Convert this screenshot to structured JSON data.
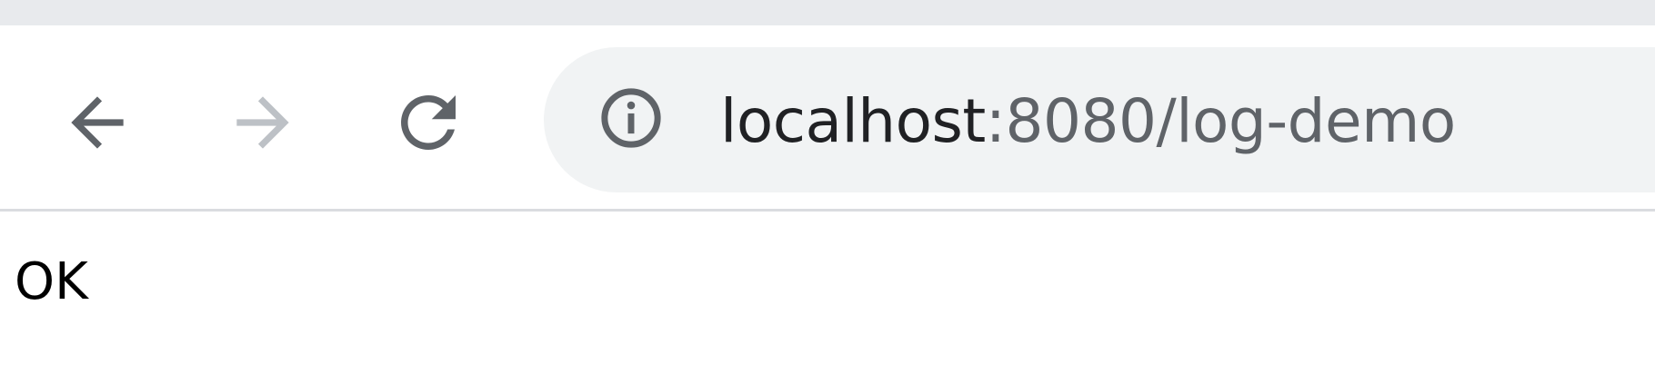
{
  "browser": {
    "nav": {
      "back_icon": "arrow-left-icon",
      "forward_icon": "arrow-right-icon",
      "reload_icon": "reload-icon"
    },
    "omnibox": {
      "info_icon": "info-icon",
      "url_host": "localhost",
      "url_rest": ":8080/log-demo"
    }
  },
  "page": {
    "body_text": "OK"
  },
  "colors": {
    "tab_strip": "#e8eaed",
    "omnibox_bg": "#f1f3f4",
    "icon_active": "#5f6368",
    "icon_disabled": "#bdc1c6",
    "url_host": "#202124",
    "url_rest": "#5f6368"
  }
}
